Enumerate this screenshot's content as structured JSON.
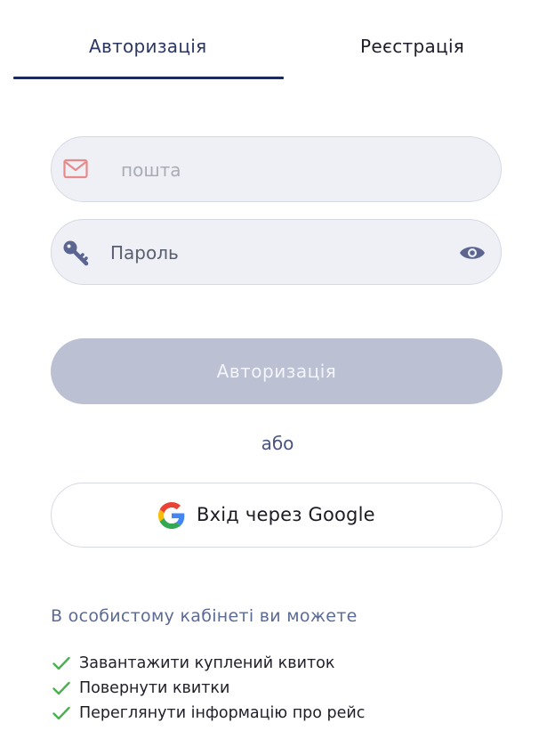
{
  "tabs": {
    "login": "Авторизація",
    "register": "Реєстрація"
  },
  "form": {
    "email_placeholder": "пошта",
    "password_placeholder": "Пароль",
    "submit_label": "Авторизація",
    "or_label": "або",
    "google_label": "Вхід через Google"
  },
  "benefits": {
    "title": "В особистому кабінеті ви можете",
    "items": [
      "Завантажити куплений квиток",
      "Повернути квитки",
      "Переглянути інформацію про рейс"
    ]
  },
  "icons": {
    "email": "mail-icon",
    "password": "key-icon",
    "visibility": "eye-icon",
    "google": "google-icon",
    "check": "check-icon"
  },
  "colors": {
    "accent": "#1f2a5c",
    "button_disabled": "#bbc1d2",
    "field_bg": "#eff0f5",
    "check": "#4caf50",
    "mail_icon": "#e8898a"
  }
}
